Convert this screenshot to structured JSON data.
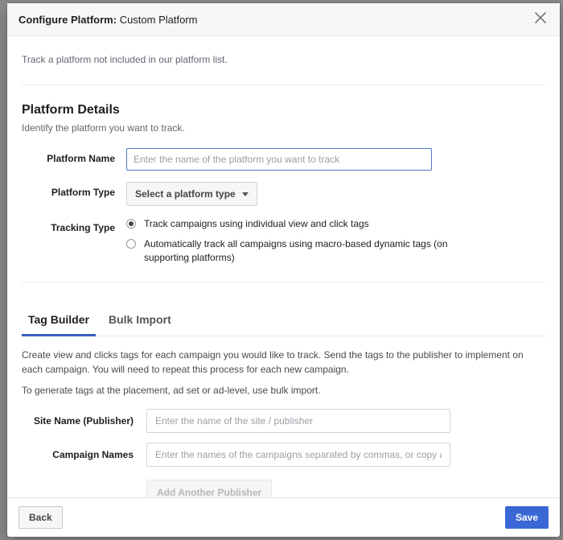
{
  "header": {
    "title_prefix": "Configure Platform:",
    "title_suffix": "Custom Platform",
    "close_icon": "close-icon"
  },
  "intro": "Track a platform not included in our platform list.",
  "details": {
    "title": "Platform Details",
    "subtitle": "Identify the platform you want to track.",
    "name_label": "Platform Name",
    "name_placeholder": "Enter the name of the platform you want to track",
    "name_value": "",
    "type_label": "Platform Type",
    "type_selected": "Select a platform type",
    "tracking_label": "Tracking Type",
    "tracking_options": [
      {
        "label": "Track campaigns using individual view and click tags",
        "checked": true
      },
      {
        "label": "Automatically track all campaigns using macro-based dynamic tags (on supporting platforms)",
        "checked": false
      }
    ]
  },
  "tabs": {
    "items": [
      {
        "label": "Tag Builder",
        "active": true
      },
      {
        "label": "Bulk Import",
        "active": false
      }
    ]
  },
  "tag_builder": {
    "desc": "Create view and clicks tags for each campaign you would like to track. Send the tags to the publisher to implement on each campaign. You will need to repeat this process for each new campaign.",
    "sub": "To generate tags at the placement, ad set or ad-level, use bulk import.",
    "site_label": "Site Name (Publisher)",
    "site_placeholder": "Enter the name of the site / publisher",
    "site_value": "",
    "campaign_label": "Campaign Names",
    "campaign_placeholder": "Enter the names of the campaigns separated by commas, or copy and paste",
    "campaign_value": "",
    "add_publisher_label": "Add Another Publisher"
  },
  "footer": {
    "back_label": "Back",
    "save_label": "Save"
  }
}
